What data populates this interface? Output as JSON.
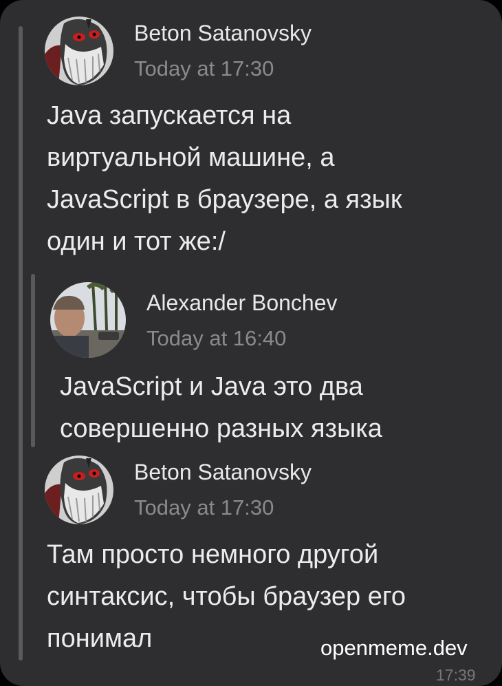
{
  "messages": [
    {
      "author": "Beton Satanovsky",
      "time": "Today at 17:30",
      "lines": [
        "Java запускается на",
        "виртуальной машине, а",
        "JavaScript в браузере, а язык",
        "один и тот же:/"
      ]
    },
    {
      "author": "Alexander Bonchev",
      "time": "Today at 16:40",
      "lines": [
        "JavaScript и Java это два",
        "совершенно разных языка"
      ]
    },
    {
      "author": "Beton Satanovsky",
      "time": "Today at 17:30",
      "lines": [
        "Там просто немного другой",
        "синтаксис, чтобы браузер его",
        "понимал"
      ]
    }
  ],
  "watermark": "openmeme.dev",
  "clock": "17:39",
  "colors": {
    "background": "#2e2e30",
    "quote_bar": "#5a5a5c",
    "text": "#ececee",
    "muted": "#8a8a8c"
  }
}
